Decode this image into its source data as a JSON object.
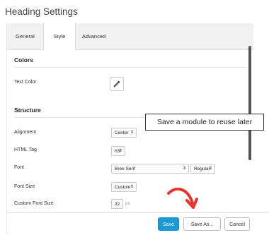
{
  "header": {
    "title": "Heading Settings"
  },
  "tabs": [
    {
      "label": "General"
    },
    {
      "label": "Style"
    },
    {
      "label": "Advanced"
    }
  ],
  "sections": {
    "colors": {
      "title": "Colors"
    },
    "structure": {
      "title": "Structure"
    }
  },
  "fields": {
    "text_color": {
      "label": "Text Color"
    },
    "alignment": {
      "label": "Alignment",
      "value": "Center"
    },
    "html_tag": {
      "label": "HTML Tag",
      "value": "h3"
    },
    "font": {
      "label": "Font",
      "value": "Bree Serif",
      "weight": "Regular"
    },
    "font_size": {
      "label": "Font Size",
      "value": "Custom"
    },
    "custom_font_size": {
      "label": "Custom Font Size",
      "value": "32",
      "unit": "px"
    }
  },
  "tooltip": {
    "text": "Save a module to reuse later"
  },
  "footer": {
    "save_label": "Save",
    "save_as_label": "Save As...",
    "cancel_label": "Cancel"
  },
  "colors": {
    "primary": "#1c9ad6",
    "annotation": "#e8342a"
  }
}
